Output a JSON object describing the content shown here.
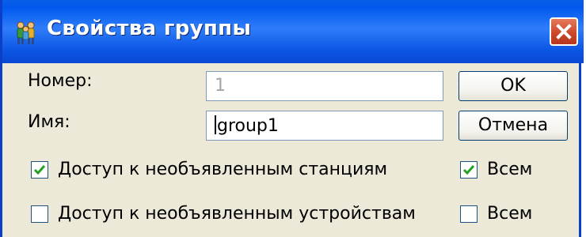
{
  "window": {
    "title": "Свойства группы",
    "icon": "group-people-icon",
    "close_icon": "close-icon",
    "accent": "#0a5fe6",
    "close_color": "#d0492f"
  },
  "form": {
    "number_label": "Номер:",
    "number_value": "1",
    "name_label": "Имя:",
    "name_value": "group1"
  },
  "buttons": {
    "ok": "OK",
    "cancel": "Отмена"
  },
  "options": {
    "stations_label": "Доступ к необъявленным станциям",
    "stations_checked": true,
    "stations_all_label": "Всем",
    "stations_all_checked": true,
    "devices_label": "Доступ к необъявленным устройствам",
    "devices_checked": false,
    "devices_all_label": "Всем",
    "devices_all_checked": false
  }
}
